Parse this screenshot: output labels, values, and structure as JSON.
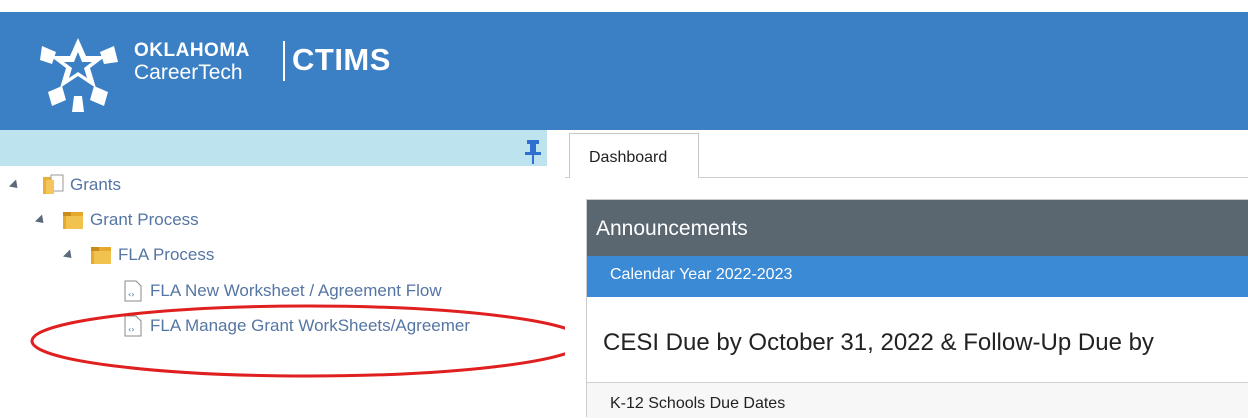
{
  "header": {
    "logo_line1": "OKLAHOMA",
    "logo_line2": "CareerTech",
    "app_name": "CTIMS",
    "background_color": "#3b7fc4"
  },
  "tree": {
    "pin_icon": "pushpin-icon",
    "nodes": [
      {
        "label": "Grants",
        "icon": "grants-folder-icon"
      },
      {
        "label": "Grant Process",
        "icon": "folder-icon"
      },
      {
        "label": "FLA Process",
        "icon": "folder-icon"
      },
      {
        "label": "FLA New Worksheet / Agreement Flow",
        "icon": "page-icon"
      },
      {
        "label": "FLA Manage Grant WorkSheets/Agreemer",
        "icon": "page-icon"
      }
    ]
  },
  "annotation": {
    "shape": "ellipse",
    "color": "#e02020"
  },
  "tabs": [
    {
      "label": "Dashboard",
      "active": true
    }
  ],
  "announcements": {
    "title": "Announcements",
    "section_header": "Calendar Year 2022-2023",
    "notice": "CESI Due by October 31, 2022 & Follow-Up Due by",
    "next_item": "K-12 Schools Due Dates"
  }
}
